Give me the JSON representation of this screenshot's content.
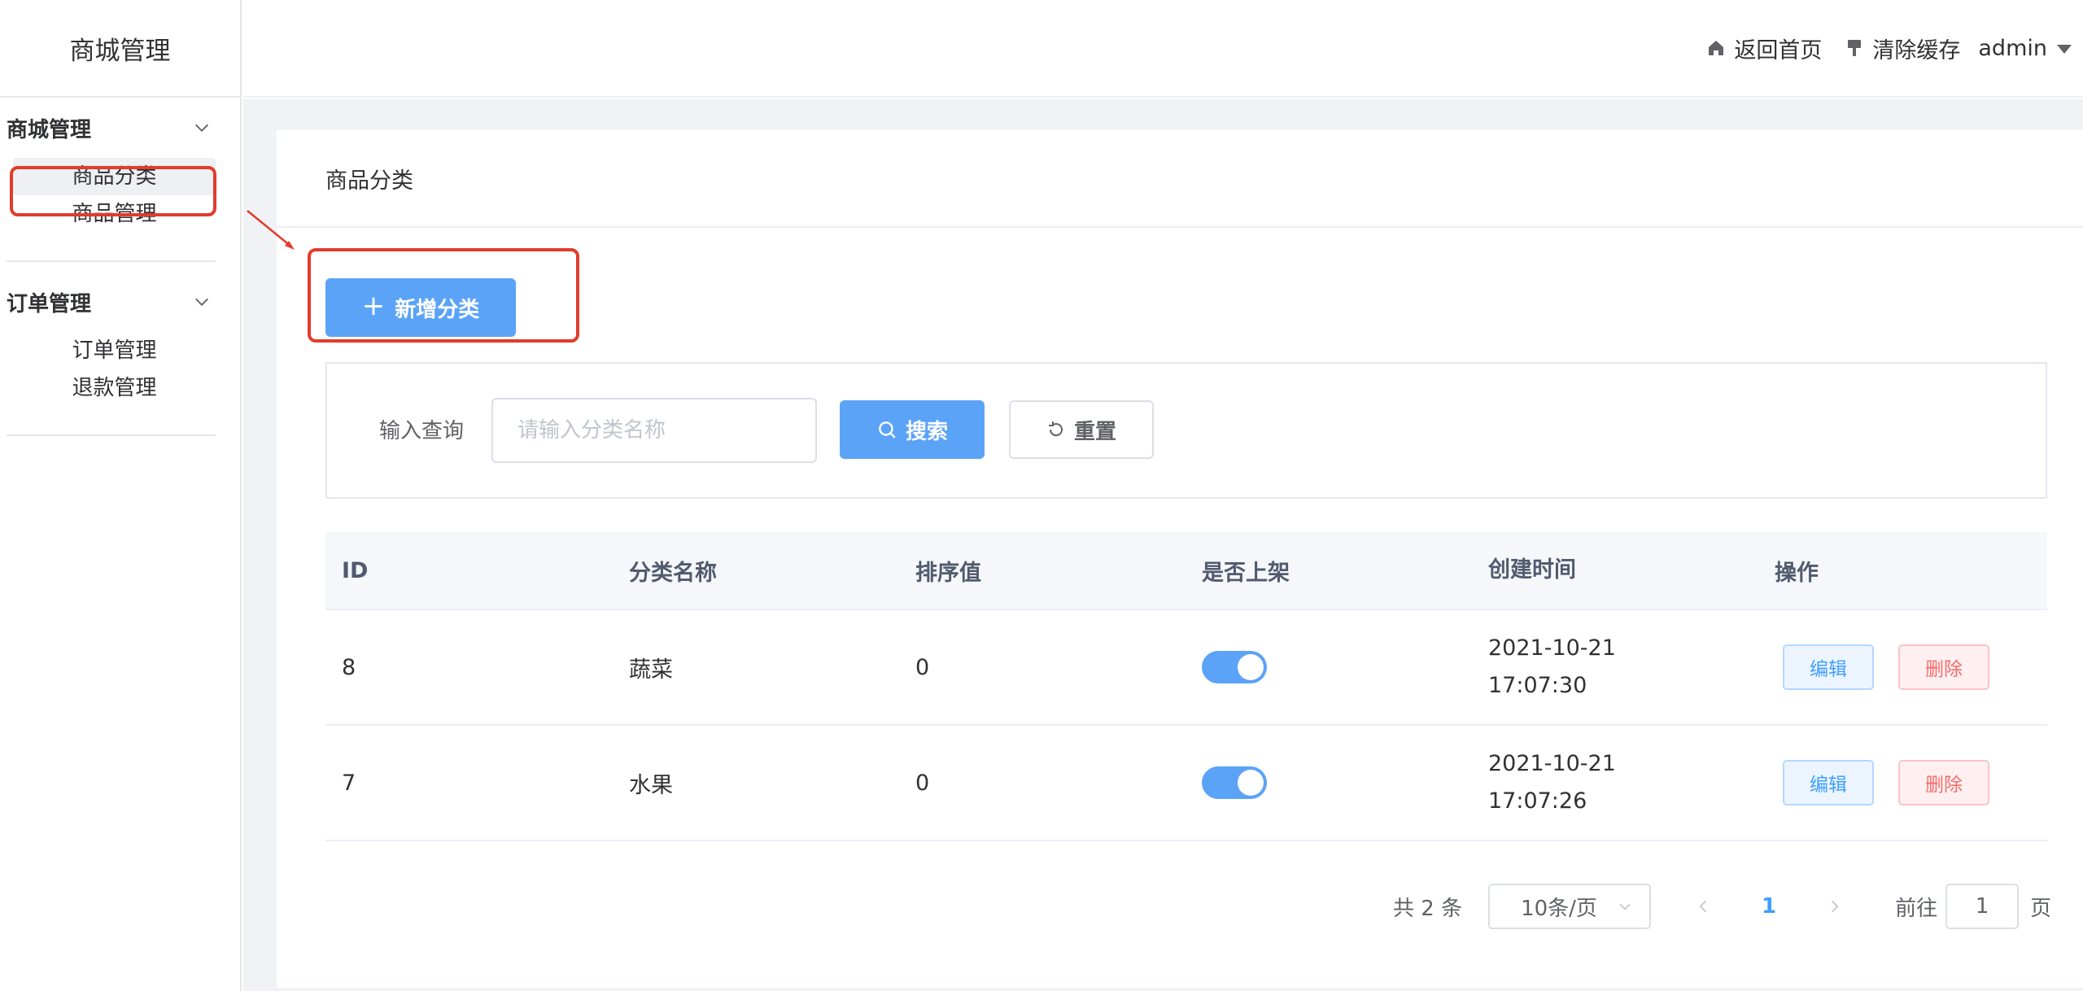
{
  "app": {
    "title": "商城管理"
  },
  "header": {
    "home_label": "返回首页",
    "clear_cache_label": "清除缓存",
    "user_name": "admin"
  },
  "sidebar": {
    "groups": [
      {
        "title": "商城管理",
        "items": [
          {
            "label": "商品分类",
            "active": true
          },
          {
            "label": "商品管理",
            "active": false
          }
        ]
      },
      {
        "title": "订单管理",
        "items": [
          {
            "label": "订单管理",
            "active": false
          },
          {
            "label": "退款管理",
            "active": false
          }
        ]
      }
    ]
  },
  "page": {
    "title": "商品分类",
    "add_button_label": "新增分类"
  },
  "search": {
    "label": "输入查询",
    "placeholder": "请输入分类名称",
    "value": "",
    "search_button_label": "搜索",
    "reset_button_label": "重置"
  },
  "table": {
    "columns": [
      "ID",
      "分类名称",
      "排序值",
      "是否上架",
      "创建时间",
      "操作"
    ],
    "rows": [
      {
        "id": "8",
        "name": "蔬菜",
        "sort": "0",
        "on_shelf": true,
        "created_date": "2021-10-21",
        "created_time": "17:07:30",
        "edit_label": "编辑",
        "delete_label": "删除"
      },
      {
        "id": "7",
        "name": "水果",
        "sort": "0",
        "on_shelf": true,
        "created_date": "2021-10-21",
        "created_time": "17:07:26",
        "edit_label": "编辑",
        "delete_label": "删除"
      }
    ]
  },
  "pagination": {
    "total_text": "共 2 条",
    "page_size": "10条/页",
    "current_page": "1",
    "goto_label": "前往",
    "goto_value": "1",
    "page_unit": "页"
  },
  "colors": {
    "primary": "#5ba3f7",
    "annotation": "#e13c2c",
    "danger": "#f56c6c"
  },
  "icons": [
    "home-icon",
    "broom-icon",
    "chevron-down-icon",
    "plus-icon",
    "search-icon",
    "refresh-icon",
    "chevron-left-icon",
    "chevron-right-icon"
  ]
}
